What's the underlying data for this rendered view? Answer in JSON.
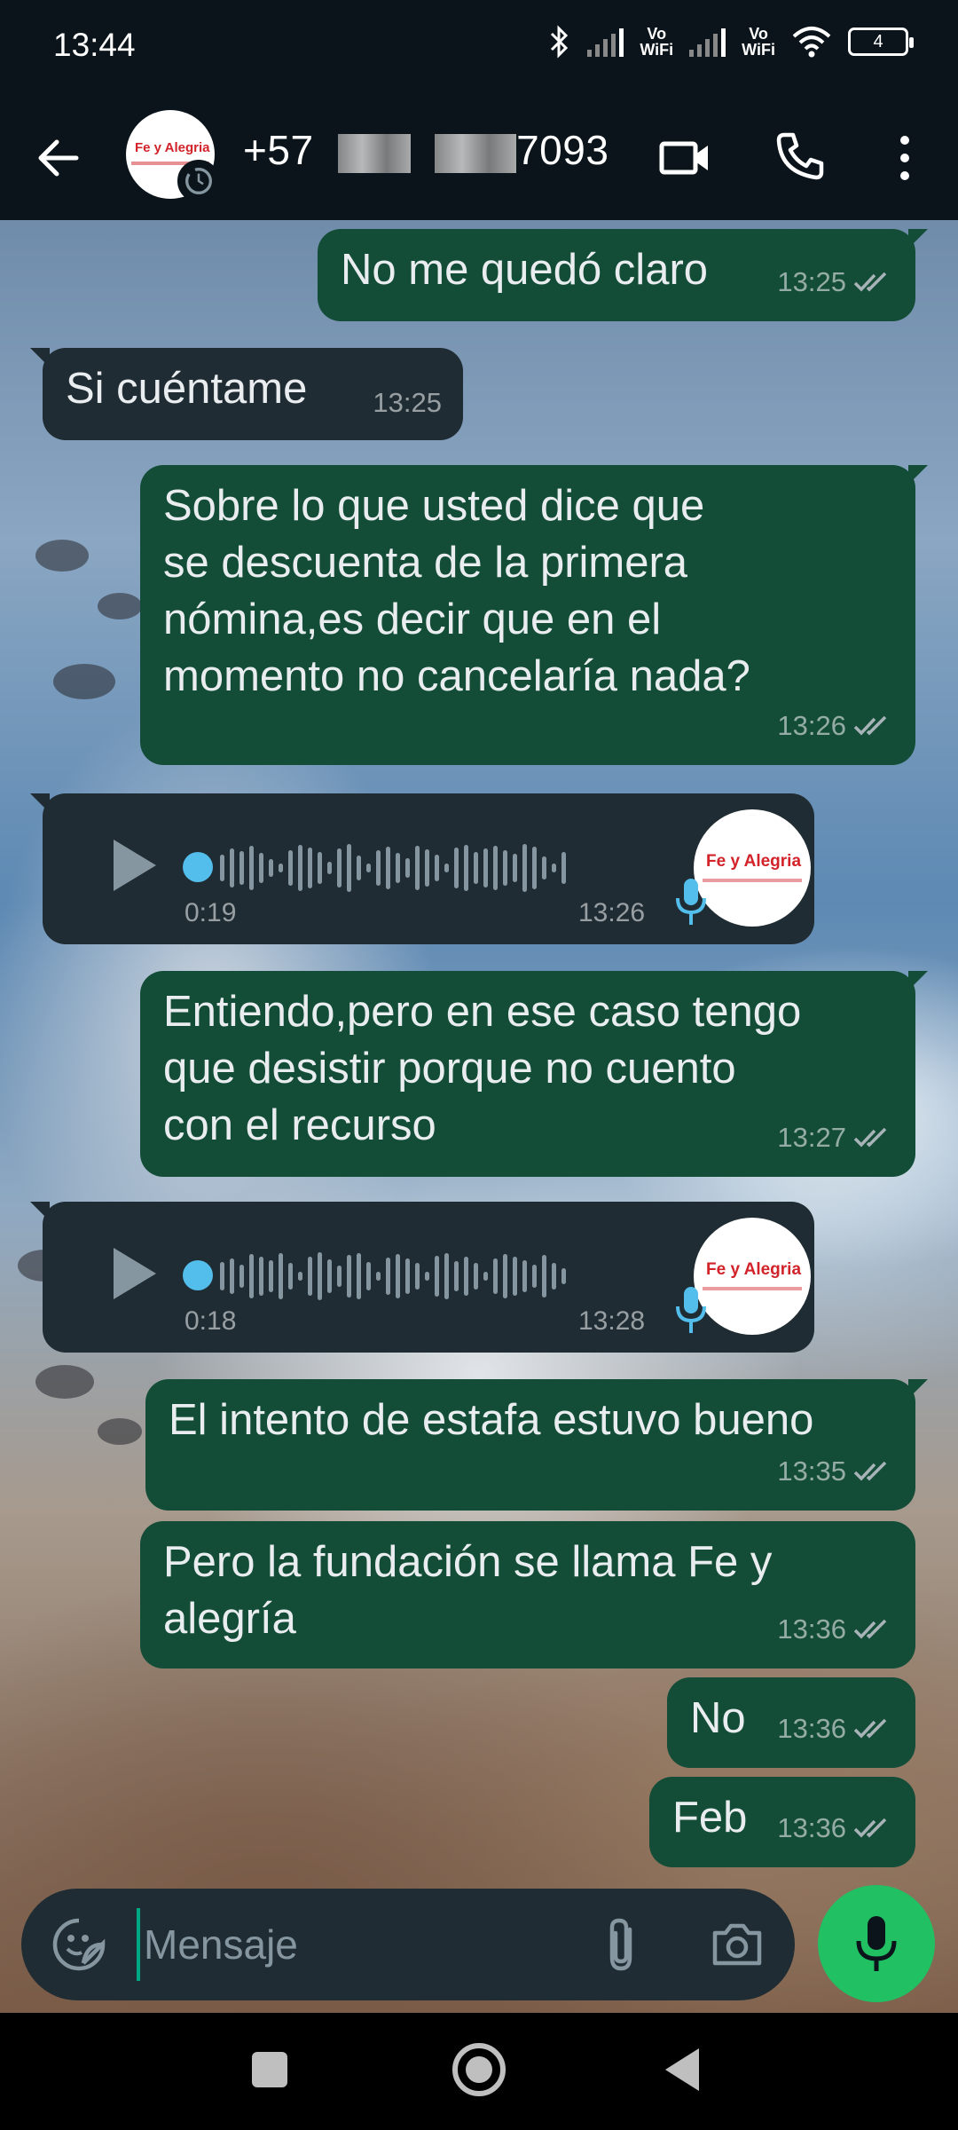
{
  "status_bar": {
    "time": "13:44",
    "vowifi_1": "Vo\nWiFi",
    "vowifi_2": "Vo\nWiFi",
    "battery": "4"
  },
  "header": {
    "contact_prefix": "+57",
    "contact_suffix": "7093",
    "avatar_logo_text": "Fe y Alegria"
  },
  "messages": [
    {
      "type": "text",
      "direction": "out",
      "text": "No me quedó claro",
      "time": "13:25",
      "read": true
    },
    {
      "type": "text",
      "direction": "in",
      "text": "Si cuéntame",
      "time": "13:25"
    },
    {
      "type": "text",
      "direction": "out",
      "text": "Sobre lo que usted dice que\nse descuenta de la primera\nnómina,es decir que en el\nmomento no cancelaría nada?",
      "time": "13:26",
      "read": true
    },
    {
      "type": "voice",
      "direction": "in",
      "duration": "0:19",
      "time": "13:26",
      "avatar_logo_text": "Fe y Alegria"
    },
    {
      "type": "text",
      "direction": "out",
      "text": "Entiendo,pero en ese caso tengo\nque desistir porque no cuento\ncon el recurso",
      "time": "13:27",
      "read": true
    },
    {
      "type": "voice",
      "direction": "in",
      "duration": "0:18",
      "time": "13:28",
      "avatar_logo_text": "Fe y Alegria"
    },
    {
      "type": "text",
      "direction": "out",
      "text": "El intento de estafa estuvo bueno",
      "time": "13:35",
      "read": true
    },
    {
      "type": "text",
      "direction": "out",
      "text": "Pero la fundación se llama Fe y\nalegría",
      "time": "13:36",
      "read": true
    },
    {
      "type": "text",
      "direction": "out",
      "text": "No",
      "time": "13:36",
      "read": true
    },
    {
      "type": "text",
      "direction": "out",
      "text": "Feb",
      "time": "13:36",
      "read": true
    }
  ],
  "composer": {
    "placeholder": "Mensaje",
    "value": ""
  },
  "icons": {
    "back": "arrow-left",
    "video": "video-camera",
    "call": "phone",
    "menu": "more-vertical",
    "emoji": "sticker-smile",
    "attach": "paperclip",
    "camera": "camera",
    "mic": "microphone",
    "play": "play"
  },
  "colors": {
    "bg": "#0b141a",
    "outgoing_bubble": "#144d37",
    "incoming_bubble": "#202c33",
    "accent_green": "#21c063",
    "read_ticks": "#a8b3b8",
    "voice_dot": "#53bdeb"
  }
}
